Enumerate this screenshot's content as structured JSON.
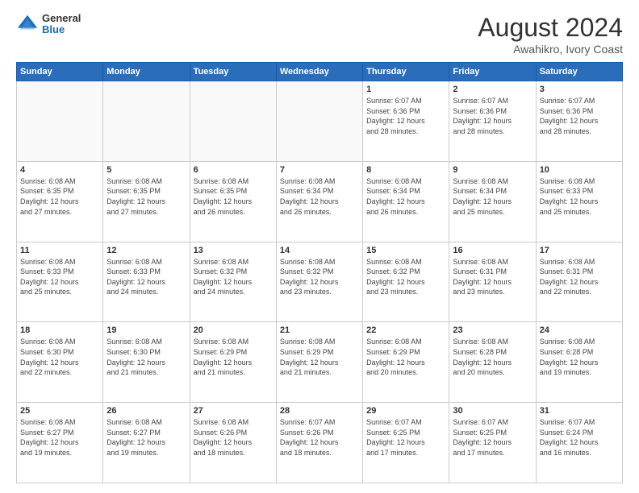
{
  "header": {
    "logo_general": "General",
    "logo_blue": "Blue",
    "title": "August 2024",
    "location": "Awahikro, Ivory Coast"
  },
  "weekdays": [
    "Sunday",
    "Monday",
    "Tuesday",
    "Wednesday",
    "Thursday",
    "Friday",
    "Saturday"
  ],
  "weeks": [
    [
      {
        "day": "",
        "info": ""
      },
      {
        "day": "",
        "info": ""
      },
      {
        "day": "",
        "info": ""
      },
      {
        "day": "",
        "info": ""
      },
      {
        "day": "1",
        "info": "Sunrise: 6:07 AM\nSunset: 6:36 PM\nDaylight: 12 hours\nand 28 minutes."
      },
      {
        "day": "2",
        "info": "Sunrise: 6:07 AM\nSunset: 6:36 PM\nDaylight: 12 hours\nand 28 minutes."
      },
      {
        "day": "3",
        "info": "Sunrise: 6:07 AM\nSunset: 6:36 PM\nDaylight: 12 hours\nand 28 minutes."
      }
    ],
    [
      {
        "day": "4",
        "info": "Sunrise: 6:08 AM\nSunset: 6:35 PM\nDaylight: 12 hours\nand 27 minutes."
      },
      {
        "day": "5",
        "info": "Sunrise: 6:08 AM\nSunset: 6:35 PM\nDaylight: 12 hours\nand 27 minutes."
      },
      {
        "day": "6",
        "info": "Sunrise: 6:08 AM\nSunset: 6:35 PM\nDaylight: 12 hours\nand 26 minutes."
      },
      {
        "day": "7",
        "info": "Sunrise: 6:08 AM\nSunset: 6:34 PM\nDaylight: 12 hours\nand 26 minutes."
      },
      {
        "day": "8",
        "info": "Sunrise: 6:08 AM\nSunset: 6:34 PM\nDaylight: 12 hours\nand 26 minutes."
      },
      {
        "day": "9",
        "info": "Sunrise: 6:08 AM\nSunset: 6:34 PM\nDaylight: 12 hours\nand 25 minutes."
      },
      {
        "day": "10",
        "info": "Sunrise: 6:08 AM\nSunset: 6:33 PM\nDaylight: 12 hours\nand 25 minutes."
      }
    ],
    [
      {
        "day": "11",
        "info": "Sunrise: 6:08 AM\nSunset: 6:33 PM\nDaylight: 12 hours\nand 25 minutes."
      },
      {
        "day": "12",
        "info": "Sunrise: 6:08 AM\nSunset: 6:33 PM\nDaylight: 12 hours\nand 24 minutes."
      },
      {
        "day": "13",
        "info": "Sunrise: 6:08 AM\nSunset: 6:32 PM\nDaylight: 12 hours\nand 24 minutes."
      },
      {
        "day": "14",
        "info": "Sunrise: 6:08 AM\nSunset: 6:32 PM\nDaylight: 12 hours\nand 23 minutes."
      },
      {
        "day": "15",
        "info": "Sunrise: 6:08 AM\nSunset: 6:32 PM\nDaylight: 12 hours\nand 23 minutes."
      },
      {
        "day": "16",
        "info": "Sunrise: 6:08 AM\nSunset: 6:31 PM\nDaylight: 12 hours\nand 23 minutes."
      },
      {
        "day": "17",
        "info": "Sunrise: 6:08 AM\nSunset: 6:31 PM\nDaylight: 12 hours\nand 22 minutes."
      }
    ],
    [
      {
        "day": "18",
        "info": "Sunrise: 6:08 AM\nSunset: 6:30 PM\nDaylight: 12 hours\nand 22 minutes."
      },
      {
        "day": "19",
        "info": "Sunrise: 6:08 AM\nSunset: 6:30 PM\nDaylight: 12 hours\nand 21 minutes."
      },
      {
        "day": "20",
        "info": "Sunrise: 6:08 AM\nSunset: 6:29 PM\nDaylight: 12 hours\nand 21 minutes."
      },
      {
        "day": "21",
        "info": "Sunrise: 6:08 AM\nSunset: 6:29 PM\nDaylight: 12 hours\nand 21 minutes."
      },
      {
        "day": "22",
        "info": "Sunrise: 6:08 AM\nSunset: 6:29 PM\nDaylight: 12 hours\nand 20 minutes."
      },
      {
        "day": "23",
        "info": "Sunrise: 6:08 AM\nSunset: 6:28 PM\nDaylight: 12 hours\nand 20 minutes."
      },
      {
        "day": "24",
        "info": "Sunrise: 6:08 AM\nSunset: 6:28 PM\nDaylight: 12 hours\nand 19 minutes."
      }
    ],
    [
      {
        "day": "25",
        "info": "Sunrise: 6:08 AM\nSunset: 6:27 PM\nDaylight: 12 hours\nand 19 minutes."
      },
      {
        "day": "26",
        "info": "Sunrise: 6:08 AM\nSunset: 6:27 PM\nDaylight: 12 hours\nand 19 minutes."
      },
      {
        "day": "27",
        "info": "Sunrise: 6:08 AM\nSunset: 6:26 PM\nDaylight: 12 hours\nand 18 minutes."
      },
      {
        "day": "28",
        "info": "Sunrise: 6:07 AM\nSunset: 6:26 PM\nDaylight: 12 hours\nand 18 minutes."
      },
      {
        "day": "29",
        "info": "Sunrise: 6:07 AM\nSunset: 6:25 PM\nDaylight: 12 hours\nand 17 minutes."
      },
      {
        "day": "30",
        "info": "Sunrise: 6:07 AM\nSunset: 6:25 PM\nDaylight: 12 hours\nand 17 minutes."
      },
      {
        "day": "31",
        "info": "Sunrise: 6:07 AM\nSunset: 6:24 PM\nDaylight: 12 hours\nand 16 minutes."
      }
    ]
  ]
}
